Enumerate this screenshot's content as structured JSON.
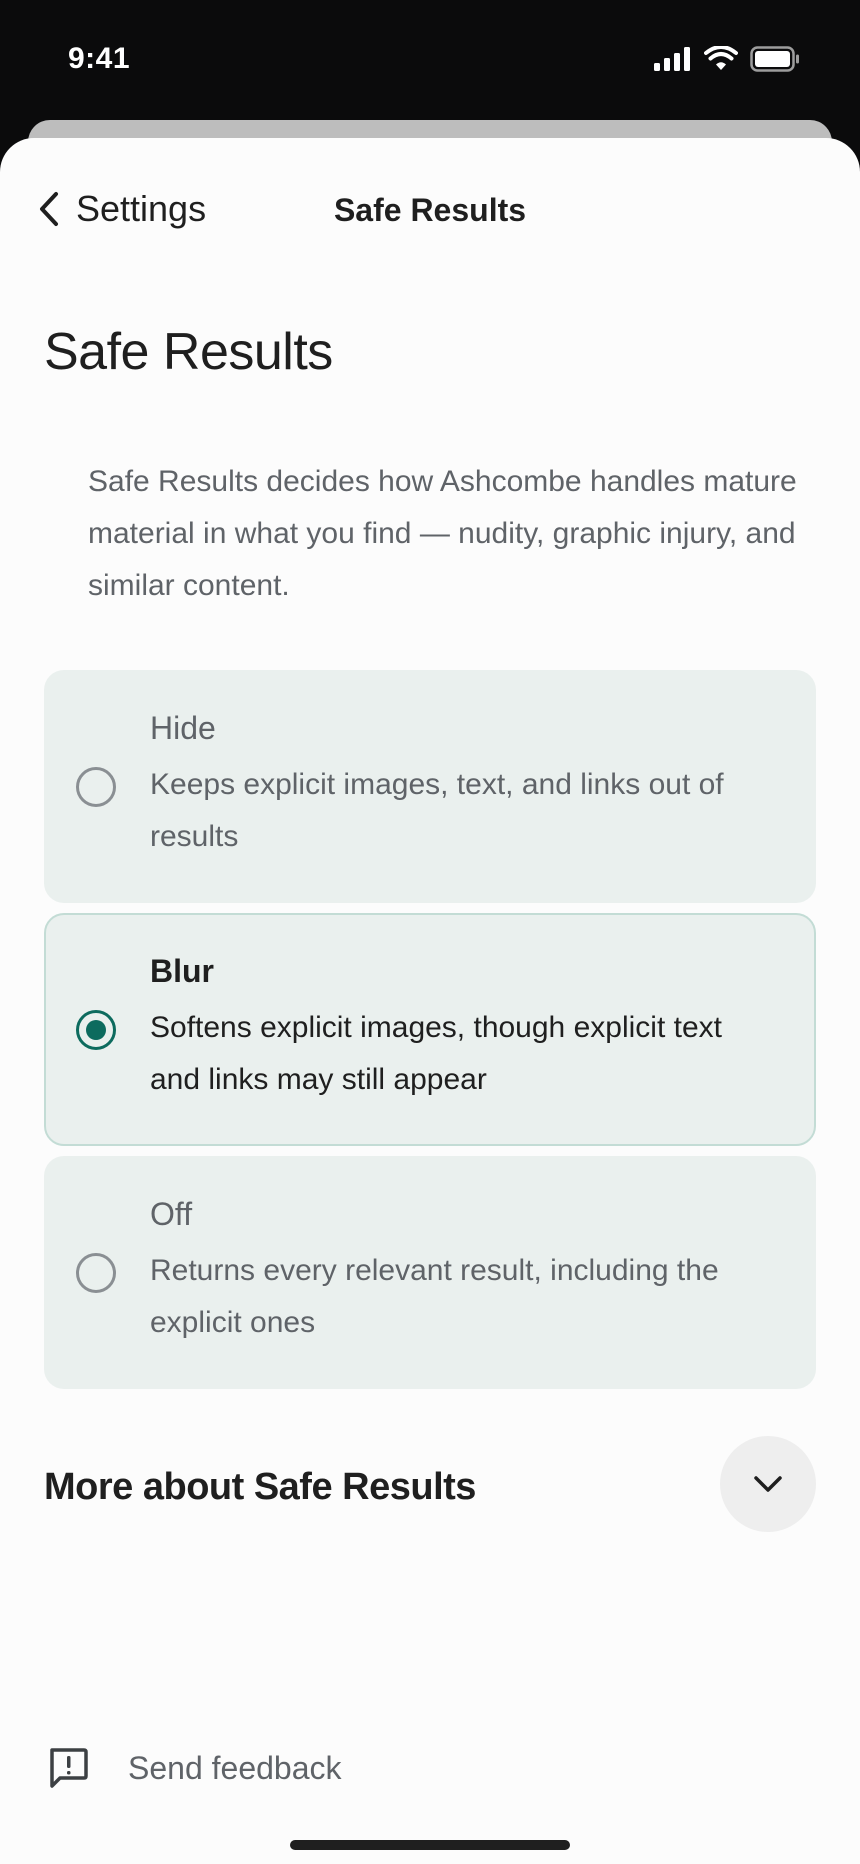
{
  "status_bar": {
    "time": "9:41"
  },
  "nav": {
    "back_label": "Settings",
    "title": "Safe Results"
  },
  "page": {
    "title": "Safe Results",
    "description": "Safe Results decides how Ashcombe handles mature material in what you find — nudity, graphic injury, and similar content."
  },
  "options": [
    {
      "label": "Hide",
      "description": "Keeps explicit images, text, and links out of results",
      "selected": false
    },
    {
      "label": "Blur",
      "description": "Softens explicit images, though explicit text and links may still appear",
      "selected": true
    },
    {
      "label": "Off",
      "description": "Returns every relevant result, including the explicit ones",
      "selected": false
    }
  ],
  "more": {
    "title": "More about Safe Results",
    "icon": "chevron-down-icon"
  },
  "feedback": {
    "label": "Send feedback",
    "icon": "feedback-icon"
  },
  "colors": {
    "accent": "#0d6b5e",
    "card_bg": "#eaf0ee",
    "text_primary": "#1f1f1f",
    "text_secondary": "#5f6368"
  }
}
